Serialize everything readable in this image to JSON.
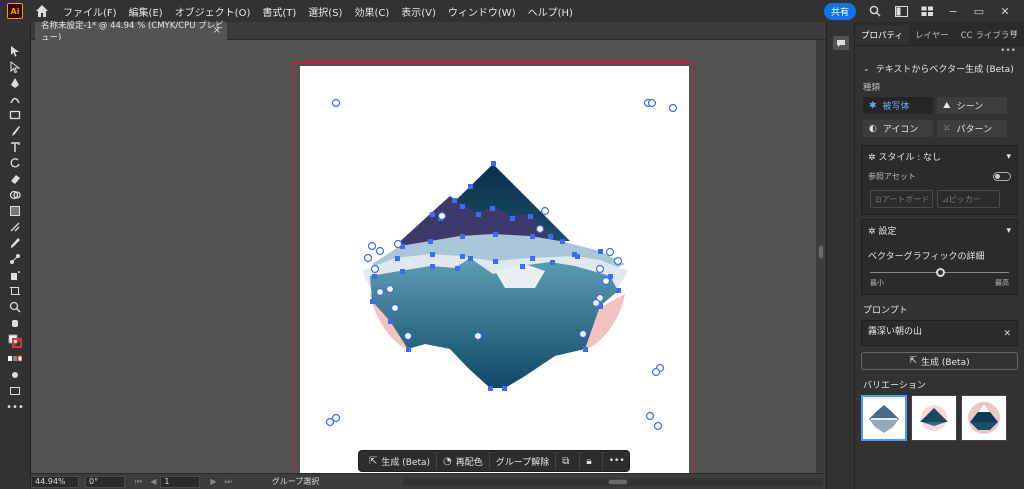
{
  "menubar": {
    "app_logo": "Ai",
    "items": [
      "ファイル(F)",
      "編集(E)",
      "オブジェクト(O)",
      "書式(T)",
      "選択(S)",
      "効果(C)",
      "表示(V)",
      "ウィンドウ(W)",
      "ヘルプ(H)"
    ],
    "share_label": "共有"
  },
  "document": {
    "tab_title": "名称未設定-1* @ 44.94 % (CMYK/CPU プレビュー)",
    "close_glyph": "×"
  },
  "context_bar": {
    "generate_label": "生成 (Beta)",
    "recolor_label": "再配色",
    "ungroup_label": "グループ解除",
    "more_glyph": "•••"
  },
  "statusbar": {
    "zoom": "44.94%",
    "rotation": "0°",
    "artboard_index": "1",
    "tool_status": "グループ選択"
  },
  "panel": {
    "tabs": [
      "プロパティ",
      "レイヤー",
      "CC ライブラリ"
    ],
    "section_title": "テキストからベクター生成 (Beta)",
    "type_label": "種類",
    "types": [
      {
        "label": "被写体",
        "icon": "✱",
        "active": true
      },
      {
        "label": "シーン",
        "icon": "⛰",
        "active": false
      },
      {
        "label": "アイコン",
        "icon": "◐",
        "active": false
      },
      {
        "label": "パターン",
        "icon": "⁙",
        "active": false
      }
    ],
    "style_label": "スタイル : なし",
    "reference_asset_label": "参照アセット",
    "artboard_btn": "アートボード",
    "picker_btn": "ピッカー",
    "settings_label": "設定",
    "detail_label": "ベクターグラフィックの詳細",
    "detail_level": 0.5,
    "detail_min": "最小",
    "detail_max": "最高",
    "prompt_label": "プロンプト",
    "prompt_value": "霧深い朝の山",
    "generate_button": "生成 (Beta)",
    "variations_label": "バリエーション"
  },
  "colors": {
    "accent": "#1473e6",
    "mountain_dark": "#0e3a57",
    "mountain_purple": "#3e3a6a",
    "fog": "#d9e4ec",
    "water": "#2c6d8a",
    "pink": "#f3c0c0",
    "selection": "#3d6cf0"
  }
}
